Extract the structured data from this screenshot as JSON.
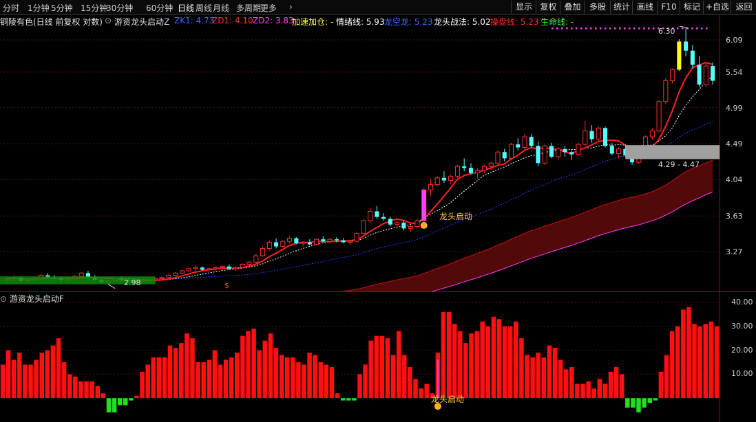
{
  "timeframes": [
    "分时",
    "1分钟",
    "5分钟",
    "15分钟",
    "30分钟",
    "60分钟",
    "日线",
    "周线",
    "月线",
    "多周期",
    "更多"
  ],
  "active_timeframe": "日线",
  "more_chevron": "›",
  "toolbar": [
    "显示",
    "复权",
    "叠加",
    "多股",
    "统计",
    "画线",
    "F10",
    "标记",
    "+自选",
    "返回"
  ],
  "stock_title": "铜陵有色(日线 前复权 对数)",
  "indicator_name": "游资龙头启动Z",
  "params": [
    {
      "label": "ZK1:",
      "value": "4.73",
      "color": "#3a6cff"
    },
    {
      "label": "ZD1:",
      "value": "4.10",
      "color": "#ff3030"
    },
    {
      "label": "ZD2:",
      "value": "3.83",
      "color": "#ff40ff"
    },
    {
      "label": "加速加仓:",
      "value": "-",
      "color": "#ffff40"
    },
    {
      "label": "情绪线:",
      "value": "5.93",
      "color": "#ffffff"
    },
    {
      "label": "龙空龙:",
      "value": "5.23",
      "color": "#3a6cff"
    },
    {
      "label": "龙头战法:",
      "value": "5.02",
      "color": "#ffffff"
    },
    {
      "label": "操盘线:",
      "value": "5.23",
      "color": "#ff3030"
    },
    {
      "label": "生命线:",
      "value": "-",
      "color": "#40ff40"
    }
  ],
  "price_labels": [
    "6.09",
    "5.54",
    "4.99",
    "4.49",
    "4.04",
    "3.63",
    "3.27"
  ],
  "annotations": {
    "high": "6.30",
    "low": "2.98",
    "box_range": "4.29 - 4.47",
    "signal_main": "龙头启动",
    "signal_sub": "龙头启动",
    "coin": "$"
  },
  "sub_title": "游资龙头启动F",
  "sub_labels": [
    "40.00",
    "30.00",
    "20.00",
    "10.00"
  ],
  "colors": {
    "up": "#ff3030",
    "down": "#54ffff",
    "grid": "#5a1010",
    "yellow": "#ffff00",
    "magenta": "#ff40ff"
  },
  "chart_data": {
    "type": "candlestick",
    "price_axis": {
      "ticks": [
        6.09,
        5.54,
        4.99,
        4.49,
        4.04,
        3.63,
        3.27
      ],
      "scale": "log"
    },
    "candles": [
      [
        3.01,
        3.04,
        2.99,
        3.02
      ],
      [
        3.02,
        3.05,
        3.0,
        3.03
      ],
      [
        3.03,
        3.04,
        2.99,
        3.0
      ],
      [
        3.0,
        3.02,
        2.98,
        3.01
      ],
      [
        3.01,
        3.03,
        2.99,
        3.02
      ],
      [
        3.02,
        3.06,
        3.01,
        3.05
      ],
      [
        3.05,
        3.07,
        3.02,
        3.03
      ],
      [
        3.03,
        3.05,
        3.0,
        3.02
      ],
      [
        3.02,
        3.04,
        2.99,
        3.01
      ],
      [
        3.01,
        3.03,
        2.99,
        3.02
      ],
      [
        3.02,
        3.05,
        3.01,
        3.04
      ],
      [
        3.04,
        3.08,
        3.03,
        3.07
      ],
      [
        3.07,
        3.09,
        3.02,
        3.03
      ],
      [
        3.03,
        3.05,
        3.0,
        3.01
      ],
      [
        3.01,
        3.02,
        2.98,
        2.99
      ],
      [
        2.99,
        3.01,
        2.97,
        3.0
      ],
      [
        3.0,
        3.03,
        2.99,
        3.02
      ],
      [
        3.02,
        3.04,
        3.0,
        3.01
      ],
      [
        3.01,
        3.03,
        2.99,
        3.0
      ],
      [
        3.0,
        3.02,
        2.98,
        2.99
      ],
      [
        2.99,
        3.01,
        2.97,
        3.0
      ],
      [
        3.0,
        3.02,
        2.98,
        3.01
      ],
      [
        3.01,
        3.03,
        2.99,
        3.02
      ],
      [
        3.02,
        3.04,
        3.0,
        3.03
      ],
      [
        3.03,
        3.06,
        3.02,
        3.05
      ],
      [
        3.05,
        3.08,
        3.04,
        3.07
      ],
      [
        3.07,
        3.1,
        3.06,
        3.09
      ],
      [
        3.09,
        3.12,
        3.08,
        3.11
      ],
      [
        3.11,
        3.14,
        3.09,
        3.12
      ],
      [
        3.12,
        3.13,
        3.09,
        3.1
      ],
      [
        3.1,
        3.12,
        3.08,
        3.11
      ],
      [
        3.11,
        3.13,
        3.09,
        3.12
      ],
      [
        3.12,
        3.14,
        3.1,
        3.13
      ],
      [
        3.13,
        3.15,
        3.1,
        3.11
      ],
      [
        3.11,
        3.13,
        3.09,
        3.12
      ],
      [
        3.12,
        3.16,
        3.11,
        3.15
      ],
      [
        3.15,
        3.18,
        3.14,
        3.17
      ],
      [
        3.17,
        3.25,
        3.16,
        3.23
      ],
      [
        3.23,
        3.32,
        3.22,
        3.3
      ],
      [
        3.3,
        3.38,
        3.28,
        3.36
      ],
      [
        3.36,
        3.4,
        3.3,
        3.32
      ],
      [
        3.32,
        3.38,
        3.31,
        3.37
      ],
      [
        3.37,
        3.42,
        3.35,
        3.4
      ],
      [
        3.4,
        3.41,
        3.34,
        3.35
      ],
      [
        3.35,
        3.37,
        3.32,
        3.36
      ],
      [
        3.36,
        3.39,
        3.33,
        3.34
      ],
      [
        3.34,
        3.4,
        3.33,
        3.39
      ],
      [
        3.39,
        3.42,
        3.36,
        3.37
      ],
      [
        3.37,
        3.4,
        3.35,
        3.39
      ],
      [
        3.39,
        3.41,
        3.36,
        3.38
      ],
      [
        3.38,
        3.4,
        3.35,
        3.36
      ],
      [
        3.36,
        3.38,
        3.33,
        3.37
      ],
      [
        3.37,
        3.46,
        3.36,
        3.45
      ],
      [
        3.45,
        3.6,
        3.44,
        3.58
      ],
      [
        3.58,
        3.72,
        3.55,
        3.68
      ],
      [
        3.68,
        3.74,
        3.6,
        3.62
      ],
      [
        3.62,
        3.66,
        3.58,
        3.6
      ],
      [
        3.6,
        3.62,
        3.52,
        3.54
      ],
      [
        3.54,
        3.58,
        3.5,
        3.56
      ],
      [
        3.56,
        3.58,
        3.48,
        3.5
      ],
      [
        3.5,
        3.54,
        3.46,
        3.52
      ],
      [
        3.52,
        3.6,
        3.5,
        3.58
      ],
      [
        3.58,
        3.94,
        3.57,
        3.92
      ],
      [
        3.92,
        4.05,
        3.85,
        3.98
      ],
      [
        3.98,
        4.08,
        3.96,
        4.06
      ],
      [
        4.06,
        4.14,
        4.0,
        4.03
      ],
      [
        4.03,
        4.1,
        3.99,
        4.08
      ],
      [
        4.08,
        4.22,
        4.06,
        4.2
      ],
      [
        4.2,
        4.3,
        4.14,
        4.18
      ],
      [
        4.18,
        4.24,
        4.1,
        4.12
      ],
      [
        4.12,
        4.18,
        4.05,
        4.15
      ],
      [
        4.15,
        4.22,
        4.12,
        4.2
      ],
      [
        4.2,
        4.26,
        4.16,
        4.24
      ],
      [
        4.24,
        4.4,
        4.22,
        4.38
      ],
      [
        4.38,
        4.42,
        4.26,
        4.3
      ],
      [
        4.3,
        4.5,
        4.28,
        4.48
      ],
      [
        4.48,
        4.56,
        4.4,
        4.44
      ],
      [
        4.44,
        4.62,
        4.42,
        4.58
      ],
      [
        4.58,
        4.62,
        4.44,
        4.46
      ],
      [
        4.46,
        4.52,
        4.2,
        4.24
      ],
      [
        4.24,
        4.48,
        4.22,
        4.46
      ],
      [
        4.46,
        4.5,
        4.3,
        4.32
      ],
      [
        4.32,
        4.44,
        4.28,
        4.42
      ],
      [
        4.42,
        4.46,
        4.32,
        4.38
      ],
      [
        4.38,
        4.4,
        4.28,
        4.35
      ],
      [
        4.35,
        4.5,
        4.33,
        4.48
      ],
      [
        4.48,
        4.8,
        4.46,
        4.66
      ],
      [
        4.66,
        4.74,
        4.5,
        4.55
      ],
      [
        4.55,
        4.72,
        4.52,
        4.7
      ],
      [
        4.7,
        4.72,
        4.44,
        4.46
      ],
      [
        4.46,
        4.5,
        4.34,
        4.36
      ],
      [
        4.36,
        4.44,
        4.3,
        4.42
      ],
      [
        4.42,
        4.48,
        4.32,
        4.34
      ],
      [
        4.34,
        4.36,
        4.22,
        4.25
      ],
      [
        4.25,
        4.4,
        4.23,
        4.38
      ],
      [
        4.38,
        4.6,
        4.36,
        4.58
      ],
      [
        4.58,
        4.7,
        4.54,
        4.66
      ],
      [
        4.66,
        5.1,
        4.64,
        5.08
      ],
      [
        5.08,
        5.44,
        5.05,
        5.4
      ],
      [
        5.4,
        5.6,
        5.36,
        5.58
      ],
      [
        5.58,
        6.1,
        5.56,
        6.06
      ],
      [
        6.06,
        6.3,
        5.8,
        5.9
      ],
      [
        5.9,
        6.0,
        5.6,
        5.66
      ],
      [
        5.66,
        5.8,
        5.3,
        5.34
      ],
      [
        5.34,
        5.7,
        5.3,
        5.64
      ],
      [
        5.64,
        5.7,
        5.34,
        5.4
      ]
    ],
    "sub_values": [
      14,
      20,
      16,
      19,
      14,
      14,
      16,
      19,
      20,
      22,
      25,
      15,
      10,
      9,
      7,
      7,
      7,
      5,
      2,
      -6,
      -6,
      -3,
      -3,
      -1,
      1,
      11,
      14,
      17,
      17,
      17,
      22,
      21,
      23,
      27,
      25,
      15,
      15,
      16,
      20,
      14,
      16,
      17,
      19,
      26,
      28,
      29,
      20,
      24,
      27,
      21,
      18,
      17,
      17,
      15,
      14,
      19,
      18,
      15,
      14,
      13,
      2,
      -1,
      -1,
      -1,
      10,
      14,
      24,
      26,
      26,
      25,
      18,
      28,
      18,
      13,
      8,
      4,
      6,
      2,
      19,
      36,
      36,
      31,
      28,
      23,
      27,
      28,
      32,
      30,
      34,
      33,
      30,
      30,
      32,
      25,
      18,
      17,
      19,
      17,
      22,
      21,
      16,
      12,
      13,
      6,
      6,
      7,
      4,
      8,
      6,
      11,
      13,
      10,
      -4,
      -4,
      -6,
      -4,
      -2,
      -1,
      11,
      18,
      28,
      30,
      37,
      38,
      31,
      30,
      31,
      32,
      30
    ],
    "sub_axis": {
      "ticks": [
        40,
        30,
        20,
        10
      ],
      "ylim": [
        -10,
        42
      ]
    }
  }
}
